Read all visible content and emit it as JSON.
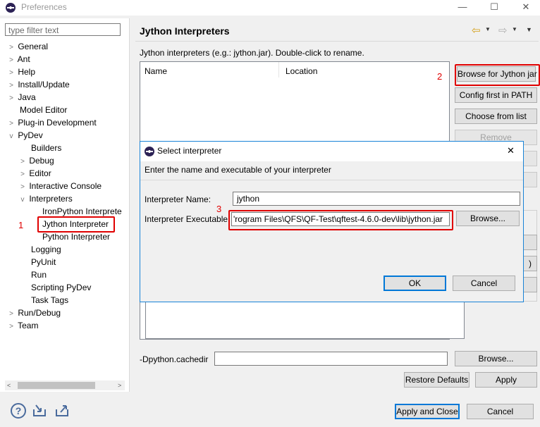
{
  "window": {
    "title": "Preferences",
    "minimize": "—",
    "maximize": "☐",
    "close": "✕"
  },
  "filter": {
    "placeholder": "type filter text"
  },
  "tree": {
    "general": "General",
    "ant": "Ant",
    "help": "Help",
    "install_update": "Install/Update",
    "java": "Java",
    "model_editor": "Model Editor",
    "plugin_dev": "Plug-in Development",
    "pydev": "PyDev",
    "builders": "Builders",
    "debug": "Debug",
    "editor": "Editor",
    "interactive_console": "Interactive Console",
    "interpreters": "Interpreters",
    "ironpython": "IronPython Interprete",
    "jython": "Jython Interpreter",
    "python": "Python Interpreter",
    "logging": "Logging",
    "pyunit": "PyUnit",
    "run": "Run",
    "scripting": "Scripting PyDev",
    "task_tags": "Task Tags",
    "run_debug": "Run/Debug",
    "team": "Team"
  },
  "annotations": {
    "one": "1",
    "two": "2",
    "three": "3"
  },
  "page": {
    "title": "Jython Interpreters",
    "description": "Jython interpreters (e.g.: jython.jar).   Double-click to rename.",
    "col_name": "Name",
    "col_location": "Location",
    "btn_browse_jython": "Browse for Jython jar",
    "btn_config_first": "Config first in PATH",
    "btn_choose_list": "Choose from list",
    "btn_remove": "Remove",
    "cachedir_label": "-Dpython.cachedir",
    "cachedir_value": "",
    "btn_browse": "Browse...",
    "btn_restore": "Restore Defaults",
    "btn_apply": "Apply",
    "partial_paren": ")"
  },
  "dialog": {
    "title": "Select interpreter",
    "close": "✕",
    "instruction": "Enter the name and executable of your interpreter",
    "name_label": "Interpreter Name:",
    "name_value": "jython",
    "exec_label": "Interpreter Executable:",
    "exec_value": "'rogram Files\\QFS\\QF-Test\\qftest-4.6.0-dev\\lib\\jython.jar",
    "browse": "Browse...",
    "ok": "OK",
    "cancel": "Cancel"
  },
  "footer": {
    "help_icon": "?",
    "apply_close": "Apply and Close",
    "cancel": "Cancel"
  },
  "colors": {
    "accent": "#0078d7",
    "highlight_red": "#e00000"
  }
}
